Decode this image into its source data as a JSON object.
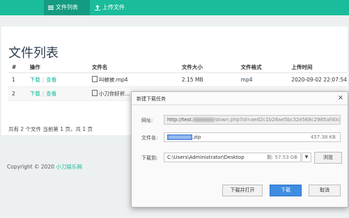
{
  "nav": {
    "items": [
      {
        "label": "文件列表",
        "icon": "list-icon",
        "active": true
      },
      {
        "label": "上传文件",
        "icon": "upload-icon",
        "active": false
      }
    ]
  },
  "page": {
    "title": "文件列表",
    "table": {
      "headers": [
        "#",
        "操作",
        "文件名",
        "文件大小",
        "文件格式",
        "上传时间"
      ],
      "rows": [
        {
          "index": "1",
          "download": "下载",
          "view": "查看",
          "filename": "叫被被.mp4",
          "size": "2.15 MB",
          "format": "mp4",
          "time": "2020-09-02 22:07:54"
        },
        {
          "index": "2",
          "download": "下载",
          "view": "查看",
          "filename": "小刀你好祈..."
        }
      ]
    },
    "summary": "共有 2 个文件  当前第 1 页，共 1 页"
  },
  "footer": {
    "copyright": "Copyright © 2020",
    "link": "小刀娱乐网"
  },
  "dialog": {
    "title": "新建下载任务",
    "url_label": "网址:",
    "url_prefix": "http://test.",
    "url_suffix": "/down.php?id=aed2c1b28ae5bc32e568c2985af40c",
    "filename_label": "文件名:",
    "filename_ext": ".zip",
    "filename_size": "457.38 KB",
    "path_label": "下载到:",
    "path": "C:\\Users\\Administrator\\Desktop",
    "free_space": "剩: 57.53 GB",
    "browse_label": "浏览",
    "open_label": "下载并打开",
    "download_label": "下载",
    "cancel_label": "取消"
  },
  "colors": {
    "navbar": "#1abc9c",
    "link": "#18bc9c",
    "primary_button": "#3f8de0"
  }
}
